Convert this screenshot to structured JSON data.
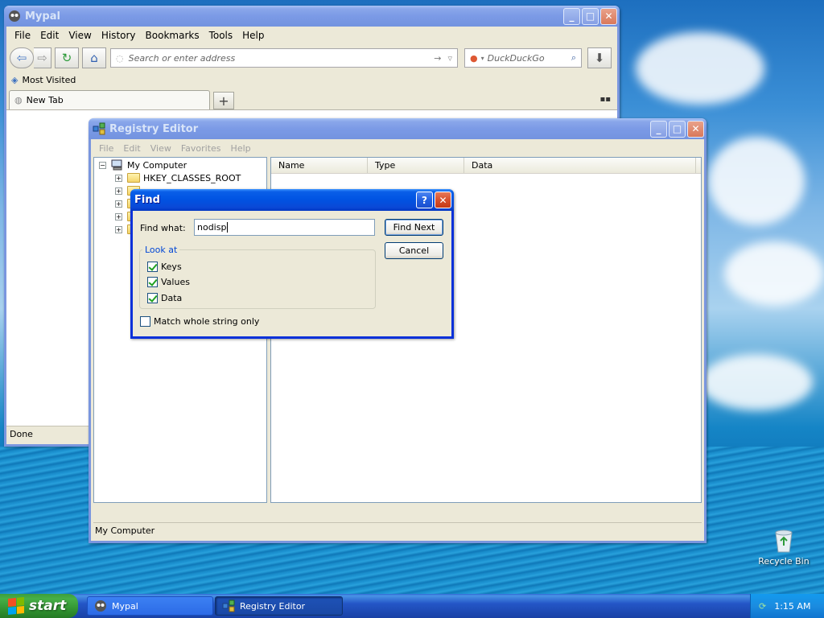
{
  "desktop": {
    "recycle_bin_label": "Recycle Bin"
  },
  "mypal": {
    "title": "Mypal",
    "menu": [
      "File",
      "Edit",
      "View",
      "History",
      "Bookmarks",
      "Tools",
      "Help"
    ],
    "address_placeholder": "Search or enter address",
    "search_engine": "DuckDuckGo",
    "bookmark": "Most Visited",
    "tab_label": "New Tab",
    "new_tab_symbol": "+",
    "status": "Done"
  },
  "regedit": {
    "title": "Registry Editor",
    "menu": [
      "File",
      "Edit",
      "View",
      "Favorites",
      "Help"
    ],
    "tree_root": "My Computer",
    "tree_items": [
      "HKEY_CLASSES_ROOT"
    ],
    "columns": [
      "Name",
      "Type",
      "Data"
    ],
    "status": "My Computer"
  },
  "find": {
    "title": "Find",
    "find_what_label": "Find what:",
    "find_what_value": "nodisp",
    "find_next_label": "Find Next",
    "cancel_label": "Cancel",
    "look_at_label": "Look at",
    "options": [
      {
        "label": "Keys",
        "checked": true
      },
      {
        "label": "Values",
        "checked": true
      },
      {
        "label": "Data",
        "checked": true
      }
    ],
    "match_whole_label": "Match whole string only",
    "match_whole_checked": false
  },
  "taskbar": {
    "start_label": "start",
    "items": [
      {
        "label": "Mypal",
        "active": false
      },
      {
        "label": "Registry Editor",
        "active": true
      }
    ],
    "clock": "1:15 AM"
  },
  "colors": {
    "titlebar_active": "#0054e3",
    "dialog_bg": "#ece9d8",
    "groupbox_title": "#0046d5",
    "checkmark": "#21a121"
  }
}
